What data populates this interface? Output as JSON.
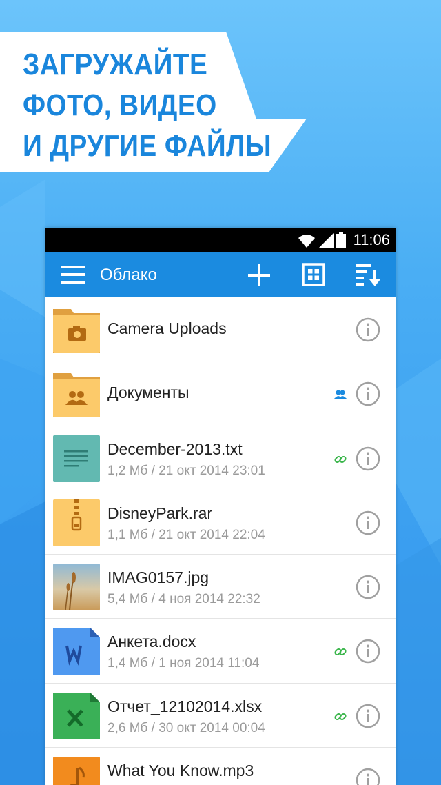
{
  "promo": {
    "line1": "ЗАГРУЖАЙТЕ",
    "line2": "ФОТО, ВИДЕО",
    "line3": "И ДРУГИЕ ФАЙЛЫ"
  },
  "statusbar": {
    "time": "11:06"
  },
  "appbar": {
    "title": "Облако"
  },
  "colors": {
    "accent": "#1b8be0",
    "folder": "#fcca6a",
    "folder_tab": "#e0a040",
    "txt": "#62b9b1",
    "word": "#4f99f0",
    "excel": "#3ab057",
    "audio": "#f28b1e",
    "link": "#39b54a",
    "shared": "#1b8be0"
  },
  "files": [
    {
      "name": "Camera Uploads",
      "meta": "",
      "icon": "camera-folder-icon",
      "badge": ""
    },
    {
      "name": "Документы",
      "meta": "",
      "icon": "shared-folder-icon",
      "badge": "shared-icon"
    },
    {
      "name": "December-2013.txt",
      "meta": "1,2 Мб / 21 окт 2014 23:01",
      "icon": "text-file-icon",
      "badge": "link-icon"
    },
    {
      "name": "DisneyPark.rar",
      "meta": "1,1 Мб / 21 окт 2014 22:04",
      "icon": "archive-icon",
      "badge": ""
    },
    {
      "name": "IMAG0157.jpg",
      "meta": "5,4 Мб / 4 ноя 2014 22:32",
      "icon": "image-thumbnail",
      "badge": ""
    },
    {
      "name": "Анкета.docx",
      "meta": "1,4 Мб / 1 ноя 2014 11:04",
      "icon": "word-file-icon",
      "badge": "link-icon"
    },
    {
      "name": "Отчет_12102014.xlsx",
      "meta": "2,6 Мб / 30 окт 2014 00:04",
      "icon": "excel-file-icon",
      "badge": "link-icon"
    },
    {
      "name": "What You Know.mp3",
      "meta": "",
      "icon": "audio-file-icon",
      "badge": ""
    }
  ]
}
